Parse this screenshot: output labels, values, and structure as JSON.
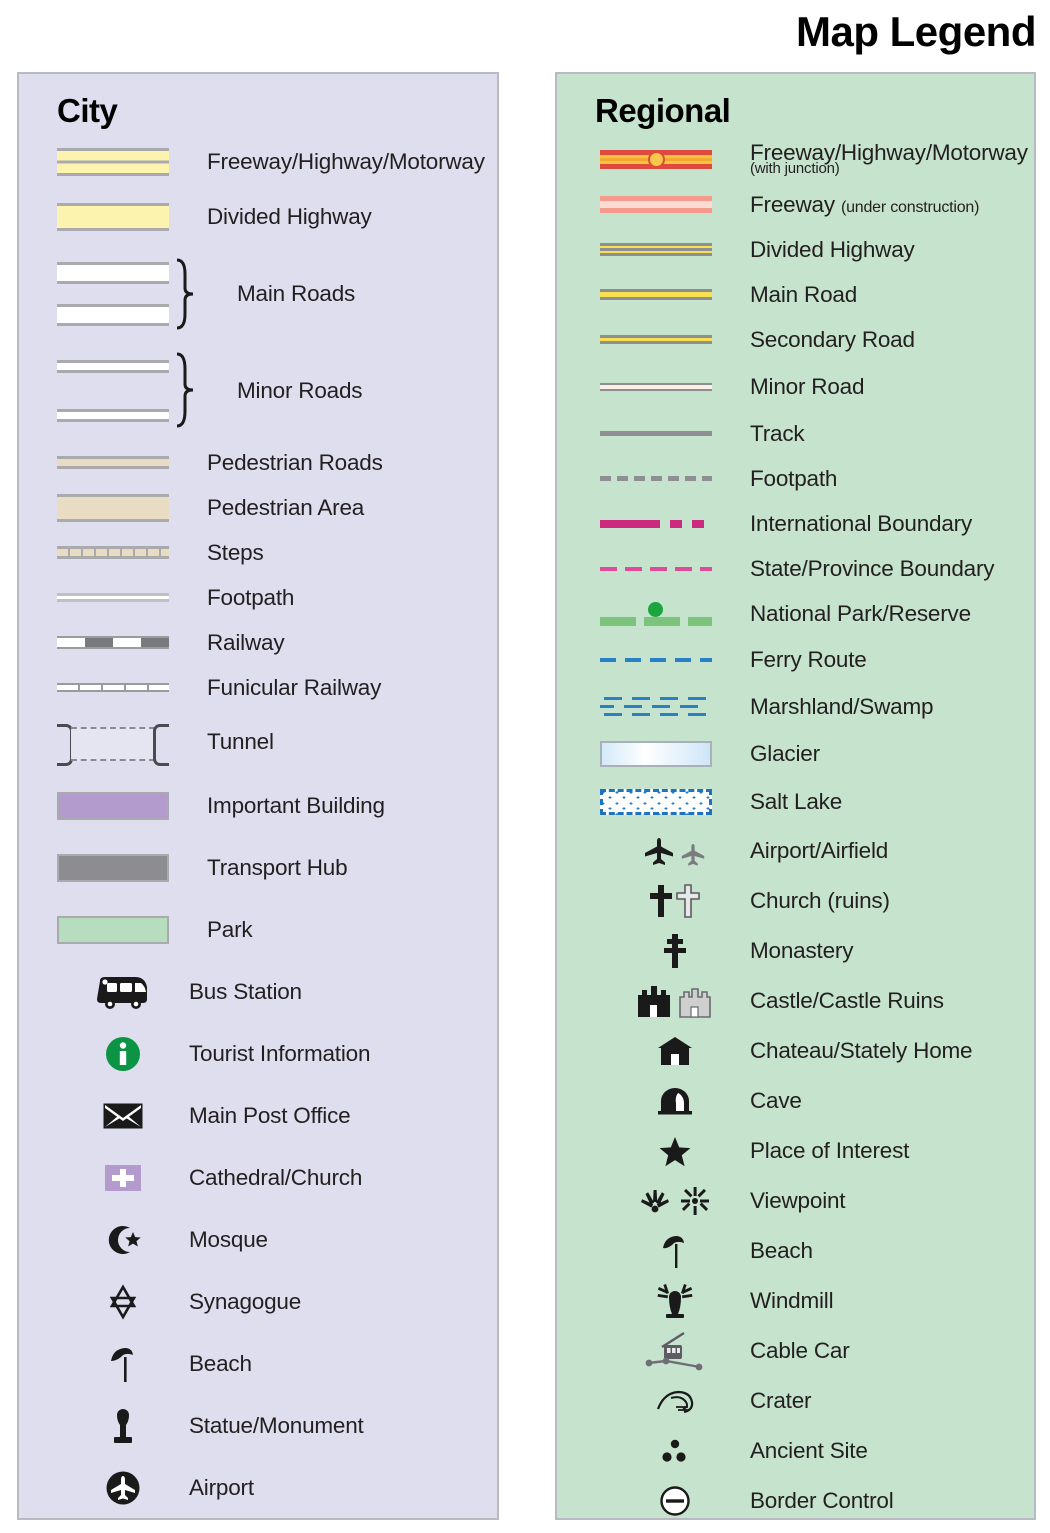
{
  "title": "Map Legend",
  "colors": {
    "city_panel_bg": "#dedeee",
    "regional_panel_bg": "#c6e3ce",
    "panel_border": "#b9b9c4",
    "road_yellow": "#fcf3ae",
    "pedestrian_tan": "#e8dcc2",
    "important_building_purple": "#b39ccd",
    "transport_hub_gray": "#8c8c91",
    "park_green": "#b6ddbd",
    "tourist_info_green": "#0b9444",
    "freeway_red": "#de4b3c",
    "freeway_yellow": "#f5c242",
    "freeway_uc_pink": "#f59a8c",
    "regional_road_yellow": "#f8e14f",
    "road_gray": "#8e8e93",
    "intl_boundary_magenta": "#cc2a7f",
    "state_boundary_pink": "#e04a9b",
    "natpark_green": "#7cc47c",
    "natpark_dot_green": "#1ba53f",
    "ferry_blue": "#2b7fc4",
    "glacier_blue": "#d4e9f7",
    "salt_lake_blue": "#1e72c0"
  },
  "city": {
    "heading": "City",
    "items": [
      {
        "symbol": "city-freeway",
        "label": "Freeway/Highway/Motorway"
      },
      {
        "symbol": "city-divided-highway",
        "label": "Divided Highway"
      },
      {
        "symbol": "city-main-roads",
        "label": "Main Roads"
      },
      {
        "symbol": "city-minor-roads",
        "label": "Minor Roads"
      },
      {
        "symbol": "city-pedestrian-roads",
        "label": "Pedestrian Roads"
      },
      {
        "symbol": "city-pedestrian-area",
        "label": "Pedestrian Area"
      },
      {
        "symbol": "city-steps",
        "label": "Steps"
      },
      {
        "symbol": "city-footpath",
        "label": "Footpath"
      },
      {
        "symbol": "city-railway",
        "label": "Railway"
      },
      {
        "symbol": "city-funicular-railway",
        "label": "Funicular Railway"
      },
      {
        "symbol": "city-tunnel",
        "label": "Tunnel"
      },
      {
        "symbol": "city-important-building",
        "label": "Important Building"
      },
      {
        "symbol": "city-transport-hub",
        "label": "Transport Hub"
      },
      {
        "symbol": "city-park",
        "label": "Park"
      },
      {
        "symbol": "city-bus-station",
        "label": "Bus Station"
      },
      {
        "symbol": "city-tourist-information",
        "label": "Tourist Information"
      },
      {
        "symbol": "city-main-post-office",
        "label": "Main Post Office"
      },
      {
        "symbol": "city-cathedral-church",
        "label": "Cathedral/Church"
      },
      {
        "symbol": "city-mosque",
        "label": "Mosque"
      },
      {
        "symbol": "city-synagogue",
        "label": "Synagogue"
      },
      {
        "symbol": "city-beach",
        "label": "Beach"
      },
      {
        "symbol": "city-statue-monument",
        "label": "Statue/Monument"
      },
      {
        "symbol": "city-airport",
        "label": "Airport"
      }
    ]
  },
  "regional": {
    "heading": "Regional",
    "items": [
      {
        "symbol": "regional-freeway-junction",
        "label": "Freeway/Highway/Motorway",
        "sublabel": "(with junction)"
      },
      {
        "symbol": "regional-freeway-under-construction",
        "label": "Freeway",
        "sublabel": "(under construction)"
      },
      {
        "symbol": "regional-divided-highway",
        "label": "Divided Highway"
      },
      {
        "symbol": "regional-main-road",
        "label": "Main Road"
      },
      {
        "symbol": "regional-secondary-road",
        "label": "Secondary Road"
      },
      {
        "symbol": "regional-minor-road",
        "label": "Minor Road"
      },
      {
        "symbol": "regional-track",
        "label": "Track"
      },
      {
        "symbol": "regional-footpath",
        "label": "Footpath"
      },
      {
        "symbol": "regional-international-boundary",
        "label": "International Boundary"
      },
      {
        "symbol": "regional-state-province-boundary",
        "label": "State/Province Boundary"
      },
      {
        "symbol": "regional-national-park",
        "label": "National Park/Reserve"
      },
      {
        "symbol": "regional-ferry-route",
        "label": "Ferry Route"
      },
      {
        "symbol": "regional-marshland",
        "label": "Marshland/Swamp"
      },
      {
        "symbol": "regional-glacier",
        "label": "Glacier"
      },
      {
        "symbol": "regional-salt-lake",
        "label": "Salt Lake"
      },
      {
        "symbol": "regional-airport-airfield",
        "label": "Airport/Airfield"
      },
      {
        "symbol": "regional-church-ruins",
        "label": "Church (ruins)"
      },
      {
        "symbol": "regional-monastery",
        "label": "Monastery"
      },
      {
        "symbol": "regional-castle-ruins",
        "label": "Castle/Castle Ruins"
      },
      {
        "symbol": "regional-chateau",
        "label": "Chateau/Stately Home"
      },
      {
        "symbol": "regional-cave",
        "label": "Cave"
      },
      {
        "symbol": "regional-place-of-interest",
        "label": "Place of Interest"
      },
      {
        "symbol": "regional-viewpoint",
        "label": "Viewpoint"
      },
      {
        "symbol": "regional-beach",
        "label": "Beach"
      },
      {
        "symbol": "regional-windmill",
        "label": "Windmill"
      },
      {
        "symbol": "regional-cable-car",
        "label": "Cable Car"
      },
      {
        "symbol": "regional-crater",
        "label": "Crater"
      },
      {
        "symbol": "regional-ancient-site",
        "label": "Ancient Site"
      },
      {
        "symbol": "regional-border-control",
        "label": "Border Control"
      }
    ]
  }
}
